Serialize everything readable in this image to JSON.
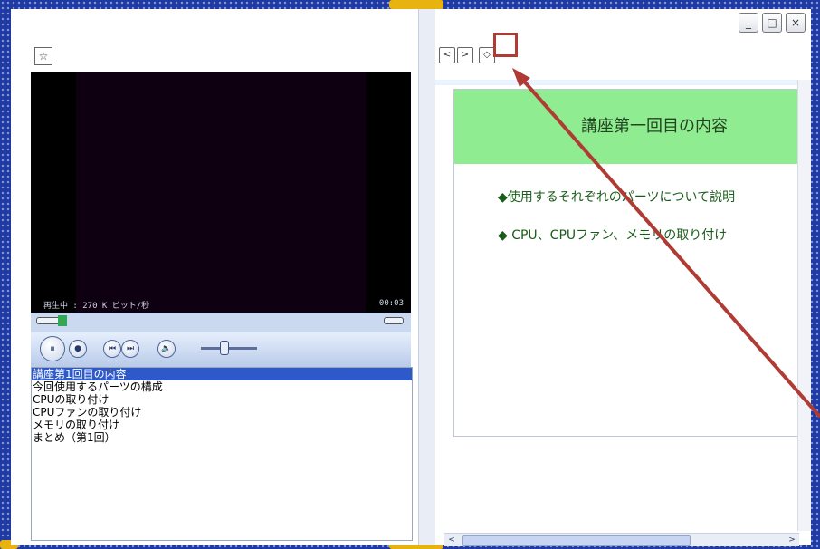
{
  "window": {
    "minimize_label": "_",
    "maximize_label": "□",
    "close_label": "×"
  },
  "left_panel": {
    "star_button_label": "☆",
    "video": {
      "status_text": "再生中 : 270 K ビット/秒",
      "time_text": "00:03"
    },
    "controls": {
      "pause_label": "⏸",
      "stop_label": "●",
      "prev_label": "⏮",
      "next_label": "⏭",
      "mute_label": "🔈",
      "volume_level": 0.4
    },
    "playlist": [
      {
        "label": "講座第1回目の内容",
        "selected": true
      },
      {
        "label": "今回使用するパーツの構成",
        "selected": false
      },
      {
        "label": "CPUの取り付け",
        "selected": false
      },
      {
        "label": "CPUファンの取り付け",
        "selected": false
      },
      {
        "label": "メモリの取り付け",
        "selected": false
      },
      {
        "label": "まとめ（第1回）",
        "selected": false
      }
    ]
  },
  "right_panel": {
    "nav": {
      "back_label": "<",
      "forward_label": ">",
      "home_label": "◇"
    },
    "slide": {
      "title": "講座第一回目の内容",
      "bullets": [
        "◆使用するそれぞれのパーツについて説明",
        "◆ CPU、CPUファン、メモリの取り付け"
      ]
    },
    "scroll_left_label": "<",
    "scroll_right_label": ">"
  },
  "colors": {
    "frame": "#1f3aa3",
    "accent_gold": "#e8b30f",
    "slide_title_bg": "#90ec90",
    "highlight": "#b03a34",
    "playlist_selected": "#2e59c8"
  }
}
